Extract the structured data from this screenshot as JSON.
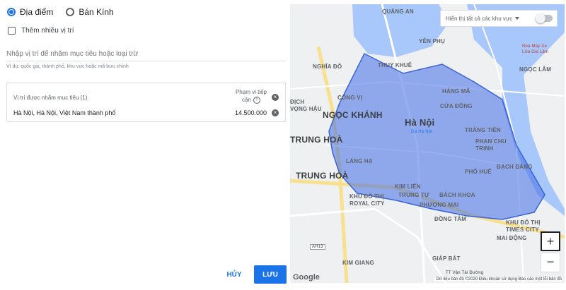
{
  "radio": {
    "options": [
      "Địa điểm",
      "Bán Kính"
    ],
    "selected": "Địa điểm"
  },
  "checkbox": {
    "label": "Thêm nhiều vị trí",
    "checked": false
  },
  "search": {
    "placeholder": "Nhập vị trí để nhắm mục tiêu hoặc loại trừ",
    "hint": "Ví dụ: quốc gia, thành phố, khu vực hoặc mã bưu chính"
  },
  "targeted": {
    "title": "Vị trí được nhắm mục tiêu (1)",
    "reach_header_line1": "Phạm vi tiếp",
    "reach_header_line2": "cận",
    "help": "?",
    "remove": "×",
    "items": [
      {
        "name": "Hà Nội, Hà Nội, Việt Nam thành phố",
        "reach": "14.500.000"
      }
    ]
  },
  "actions": {
    "cancel": "HỦY",
    "save": "LƯU"
  },
  "map": {
    "toggle_label": "Hiển thị tất cả các khu vực",
    "toggle_on": false,
    "zoom_in": "+",
    "zoom_out": "−",
    "logo": "Google",
    "attribution": "Dữ liệu bản đồ ©2020   Điều khoản sử dụng   Báo cáo một lỗi bản đồ",
    "labels": {
      "quang_an": "QUẢNG AN",
      "yen_phu": "YÊN PHỤ",
      "nhat_tan": "Nhà Máy Xe\nLửa Gia Lâm",
      "nghia_do": "NGHĨA ĐÔ",
      "thuy_khue": "THỤY KHUÊ",
      "ngoc_lam": "NGỌC LÂM",
      "cong_vi": "CỐNG VỊ",
      "hang_ma": "HÀNG MÃ",
      "dich_vong": "ĐỊCH\nVỌNG HẬU",
      "ngoc_khanh": "NGỌC KHÁNH",
      "cua_dong": "CỬA ĐÔNG",
      "ha_noi": "Hà Nội",
      "ga_ha_noi": "Ga Hà Nội",
      "trang_tien": "TRÀNG TIỀN",
      "trung_hoa_top": "TRUNG HOÀ",
      "phan_chu_trinh": "PHAN CHU\nTRINH",
      "lang_ha": "LÁNG HẠ",
      "bach_dang": "BẠCH ĐẰNG",
      "trung_hoa": "TRUNG HOÀ",
      "pho_hue": "PHỐ HUẾ",
      "kim_lien": "KIM LIÊN",
      "trung_tu": "TRUNG TỰ",
      "bach_khoa": "BÁCH KHOA",
      "khu_do_thi_royal": "KHU ĐÔ THỊ\nROYAL CITY",
      "phuong_mai": "PHƯƠNG MAI",
      "dong_tam": "ĐỒNG TÂM",
      "times_city": "KHU ĐÔ THỊ\nTIMES CITY",
      "mai_dong": "MAI ĐỘNG",
      "kim_giang": "KIM GIANG",
      "giap_bat": "GIÁP BÁT",
      "van_tai": "TT Vận Tải Đường",
      "ah13": "AH13"
    }
  }
}
